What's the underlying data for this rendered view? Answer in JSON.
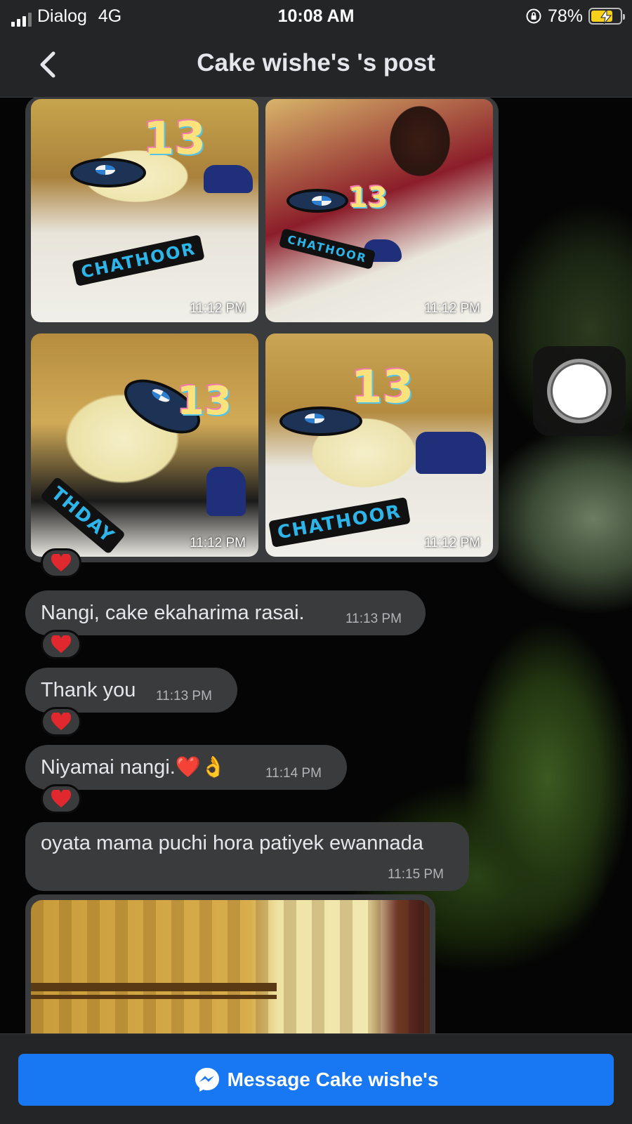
{
  "status_bar": {
    "carrier": "Dialog",
    "network": "4G",
    "time": "10:08 AM",
    "battery": "78%",
    "battery_level": 0.78
  },
  "header": {
    "title": "Cake wishe's 's post",
    "back_icon": "chevron-left-icon"
  },
  "photos": [
    {
      "timestamp": "11:12 PM",
      "candle": "13",
      "road_text": "CHATHOOR"
    },
    {
      "timestamp": "11:12 PM",
      "candle": "13",
      "road_text": "CHATHOOR"
    },
    {
      "timestamp": "11:12 PM",
      "candle": "13",
      "road_text": "THDAY"
    },
    {
      "timestamp": "11:12 PM",
      "candle": "13",
      "road_text": "CHATHOOR"
    }
  ],
  "messages": [
    {
      "text": "Nangi, cake ekaharima rasai.",
      "time": "11:13 PM"
    },
    {
      "text": "Thank you",
      "time": "11:13 PM"
    },
    {
      "text": "Niyamai  nangi.❤️👌",
      "time": "11:14 PM"
    },
    {
      "text": "oyata mama puchi hora patiyek ewannada",
      "time": "11:15 PM"
    }
  ],
  "reaction_emoji": "heart-icon",
  "bottom_button": {
    "label": "Message Cake wishe's",
    "icon": "messenger-icon"
  },
  "colors": {
    "accent": "#1877f2",
    "bubble": "#3a3b3c",
    "bar": "#242526",
    "heart": "#e0282e"
  }
}
